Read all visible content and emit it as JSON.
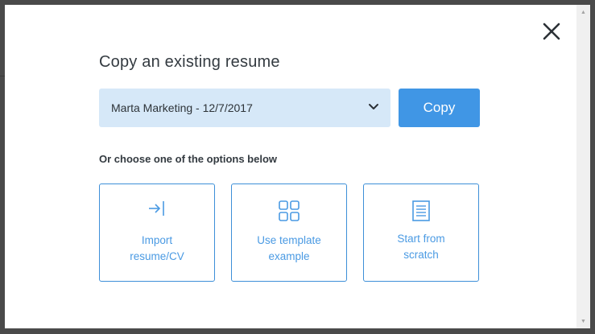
{
  "modal": {
    "title": "Copy an existing resume",
    "resume_select": {
      "selected_value": "Marta Marketing - 12/7/2017"
    },
    "copy_button_label": "Copy",
    "options_heading": "Or choose one of the options below",
    "options": [
      {
        "line1": "Import",
        "line2": "resume/CV",
        "icon": "import-icon"
      },
      {
        "line1": "Use template",
        "line2": "example",
        "icon": "grid-icon"
      },
      {
        "line1": "Start from",
        "line2": "scratch",
        "icon": "document-icon"
      }
    ],
    "close_icon": "close-icon"
  },
  "colors": {
    "accent": "#4096e5",
    "select_bg": "#d6e8f8",
    "text_dark": "#333a40",
    "backdrop": "#4a4a4a"
  }
}
